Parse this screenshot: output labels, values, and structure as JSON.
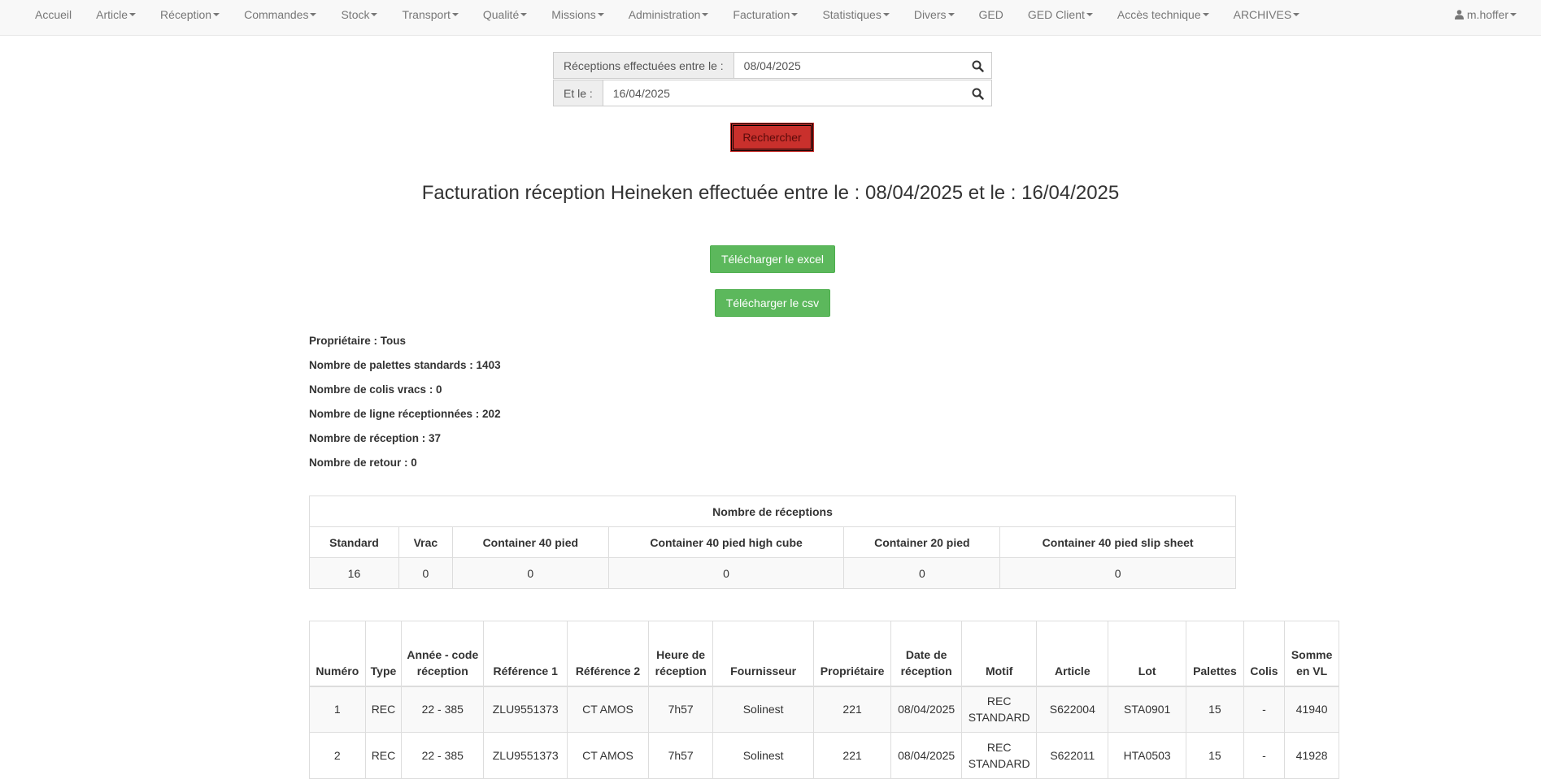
{
  "nav": {
    "items": [
      {
        "label": "Accueil",
        "dropdown": false
      },
      {
        "label": "Article",
        "dropdown": true
      },
      {
        "label": "Réception",
        "dropdown": true
      },
      {
        "label": "Commandes",
        "dropdown": true
      },
      {
        "label": "Stock",
        "dropdown": true
      },
      {
        "label": "Transport",
        "dropdown": true
      },
      {
        "label": "Qualité",
        "dropdown": true
      },
      {
        "label": "Missions",
        "dropdown": true
      },
      {
        "label": "Administration",
        "dropdown": true
      },
      {
        "label": "Facturation",
        "dropdown": true
      },
      {
        "label": "Statistiques",
        "dropdown": true
      },
      {
        "label": "Divers",
        "dropdown": true
      },
      {
        "label": "GED",
        "dropdown": false
      },
      {
        "label": "GED Client",
        "dropdown": true
      },
      {
        "label": "Accès technique",
        "dropdown": true
      },
      {
        "label": "ARCHIVES",
        "dropdown": true
      }
    ],
    "user": "m.hoffer"
  },
  "search": {
    "start_label": "Réceptions effectuées entre le :",
    "start_value": "08/04/2025",
    "end_label": "Et le :",
    "end_value": "16/04/2025",
    "button": "Rechercher"
  },
  "title": "Facturation réception Heineken effectuée entre le : 08/04/2025 et le : 16/04/2025",
  "downloads": {
    "excel": "Télécharger le excel",
    "csv": "Télécharger le csv"
  },
  "stats": [
    "Propriétaire : Tous",
    "Nombre de palettes standards : 1403",
    "Nombre de colis vracs : 0",
    "Nombre de ligne réceptionnées : 202",
    "Nombre de réception : 37",
    "Nombre de retour : 0"
  ],
  "summary": {
    "caption": "Nombre de réceptions",
    "headers": [
      "Standard",
      "Vrac",
      "Container 40 pied",
      "Container 40 pied high cube",
      "Container 20 pied",
      "Container 40 pied slip sheet"
    ],
    "values": [
      "16",
      "0",
      "0",
      "0",
      "0",
      "0"
    ]
  },
  "detail": {
    "headers": [
      "Numéro",
      "Type",
      "Année - code réception",
      "Référence 1",
      "Référence 2",
      "Heure de réception",
      "Fournisseur",
      "Propriétaire",
      "Date de réception",
      "Motif",
      "Article",
      "Lot",
      "Palettes",
      "Colis",
      "Somme en VL"
    ],
    "rows": [
      [
        "1",
        "REC",
        "22 - 385",
        "ZLU9551373",
        "CT AMOS",
        "7h57",
        "Solinest",
        "221",
        "08/04/2025",
        "REC STANDARD",
        "S622004",
        "STA0901",
        "15",
        "-",
        "41940"
      ],
      [
        "2",
        "REC",
        "22 - 385",
        "ZLU9551373",
        "CT AMOS",
        "7h57",
        "Solinest",
        "221",
        "08/04/2025",
        "REC STANDARD",
        "S622011",
        "HTA0503",
        "15",
        "-",
        "41928"
      ]
    ]
  }
}
